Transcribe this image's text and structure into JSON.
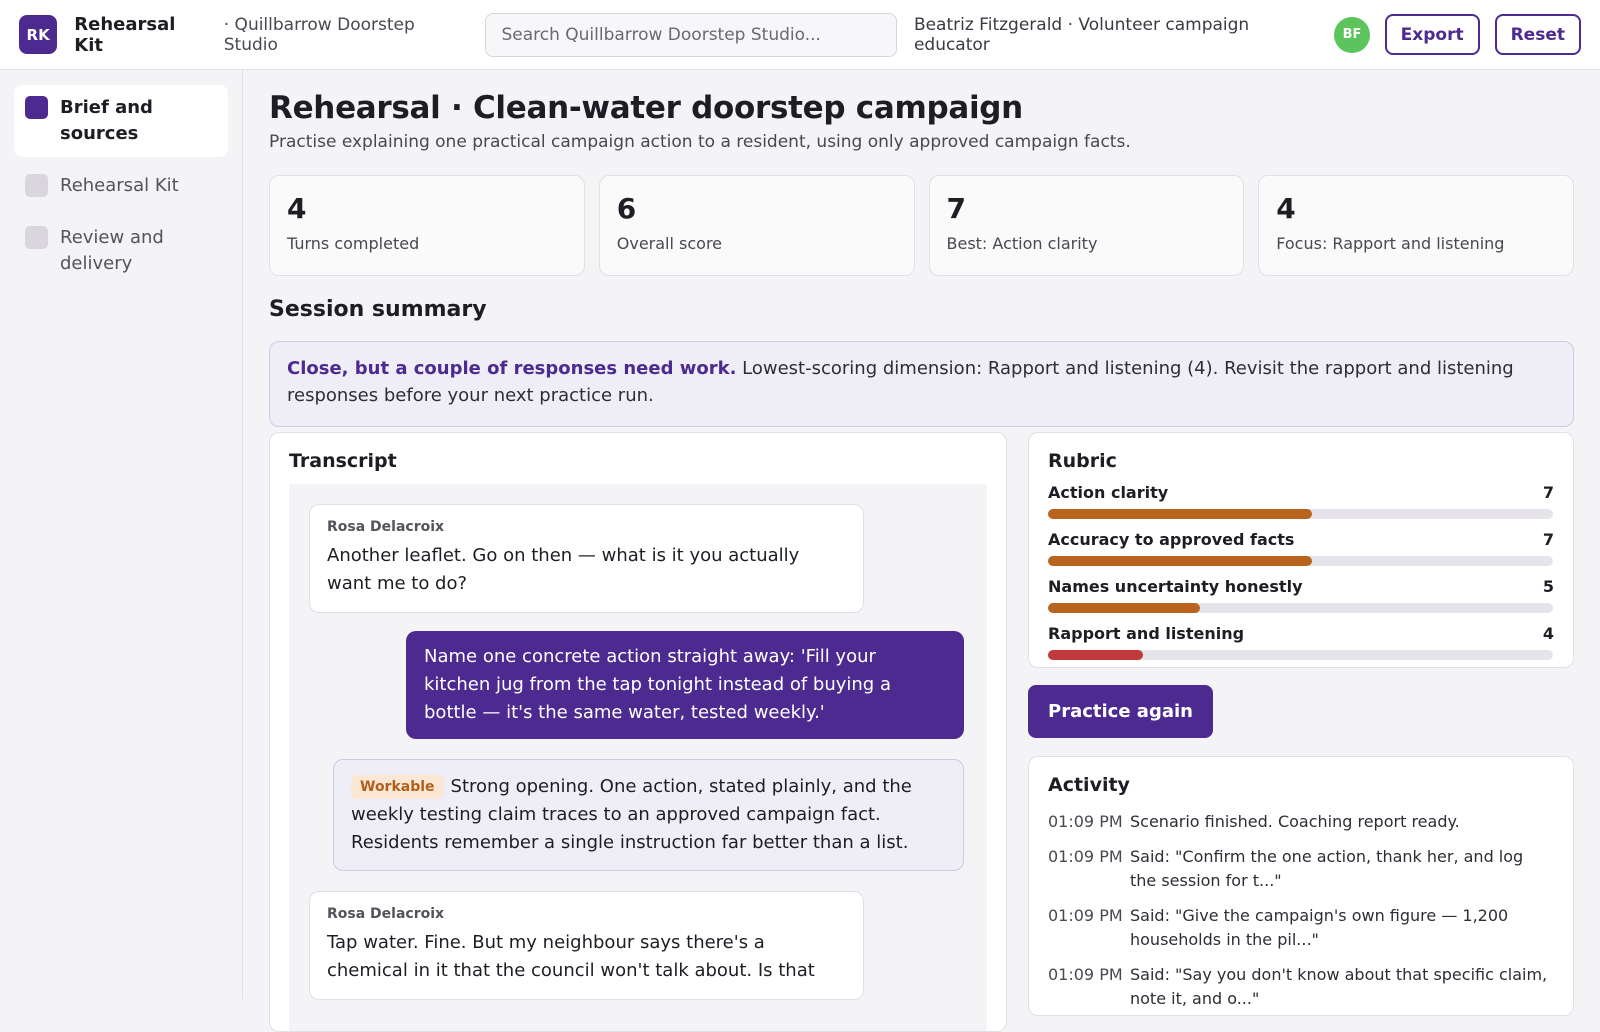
{
  "header": {
    "logo_text": "RK",
    "app_name": "Rehearsal Kit",
    "workspace": "· Quillbarrow Doorstep Studio",
    "search_placeholder": "Search Quillbarrow Doorstep Studio...",
    "user_line": "Beatriz Fitzgerald · Volunteer campaign educator",
    "avatar_initials": "BF",
    "export_label": "Export",
    "reset_label": "Reset"
  },
  "sidebar": {
    "items": [
      {
        "label": "Brief and sources",
        "active": true
      },
      {
        "label": "Rehearsal Kit",
        "active": false
      },
      {
        "label": "Review and delivery",
        "active": false
      }
    ]
  },
  "main": {
    "title": "Rehearsal · Clean-water doorstep campaign",
    "subtitle": "Practise explaining one practical campaign action to a resident, using only approved campaign facts.",
    "stats": [
      {
        "value": "4",
        "label": "Turns completed"
      },
      {
        "value": "6",
        "label": "Overall score"
      },
      {
        "value": "7",
        "label": "Best: Action clarity"
      },
      {
        "value": "4",
        "label": "Focus: Rapport and listening"
      }
    ],
    "summary_title": "Session summary",
    "summary_strong": "Close, but a couple of responses need work.",
    "summary_text": " Lowest-scoring dimension: Rapport and listening (4). Revisit the rapport and listening responses before your next practice run."
  },
  "transcript": {
    "title": "Transcript",
    "messages": [
      {
        "speaker": "Rosa Delacroix",
        "text": "Another leaflet. Go on then — what is it you actually want me to do?"
      },
      {
        "text": "Name one concrete action straight away: 'Fill your kitchen jug from the tap tonight instead of buying a bottle — it's the same water, tested weekly.'"
      },
      {
        "badge": "Workable",
        "text": "Strong opening. One action, stated plainly, and the weekly testing claim traces to an approved campaign fact. Residents remember a single instruction far better than a list."
      },
      {
        "speaker": "Rosa Delacroix",
        "text": "Tap water. Fine. But my neighbour says there's a chemical in it that the council won't talk about. Is that"
      }
    ]
  },
  "rubric": {
    "title": "Rubric",
    "max": 10,
    "rows": [
      {
        "label": "Action clarity",
        "score": 7,
        "value": "7",
        "color": "#b8641f"
      },
      {
        "label": "Accuracy to approved facts",
        "score": 7,
        "value": "7",
        "color": "#b8641f"
      },
      {
        "label": "Names uncertainty honestly",
        "score": 5,
        "value": "5",
        "color": "#b8641f"
      },
      {
        "label": "Rapport and listening",
        "score": 4,
        "value": "4",
        "color": "#c0393b"
      }
    ]
  },
  "practice_label": "Practice again",
  "activity": {
    "title": "Activity",
    "items": [
      {
        "time": "01:09 PM",
        "text": "Scenario finished. Coaching report ready."
      },
      {
        "time": "01:09 PM",
        "text": "Said: \"Confirm the one action, thank her, and log the session for t...\""
      },
      {
        "time": "01:09 PM",
        "text": "Said: \"Give the campaign's own figure — 1,200 households in the pil...\""
      },
      {
        "time": "01:09 PM",
        "text": "Said: \"Say you don't know about that specific claim, note it, and o...\""
      }
    ]
  }
}
